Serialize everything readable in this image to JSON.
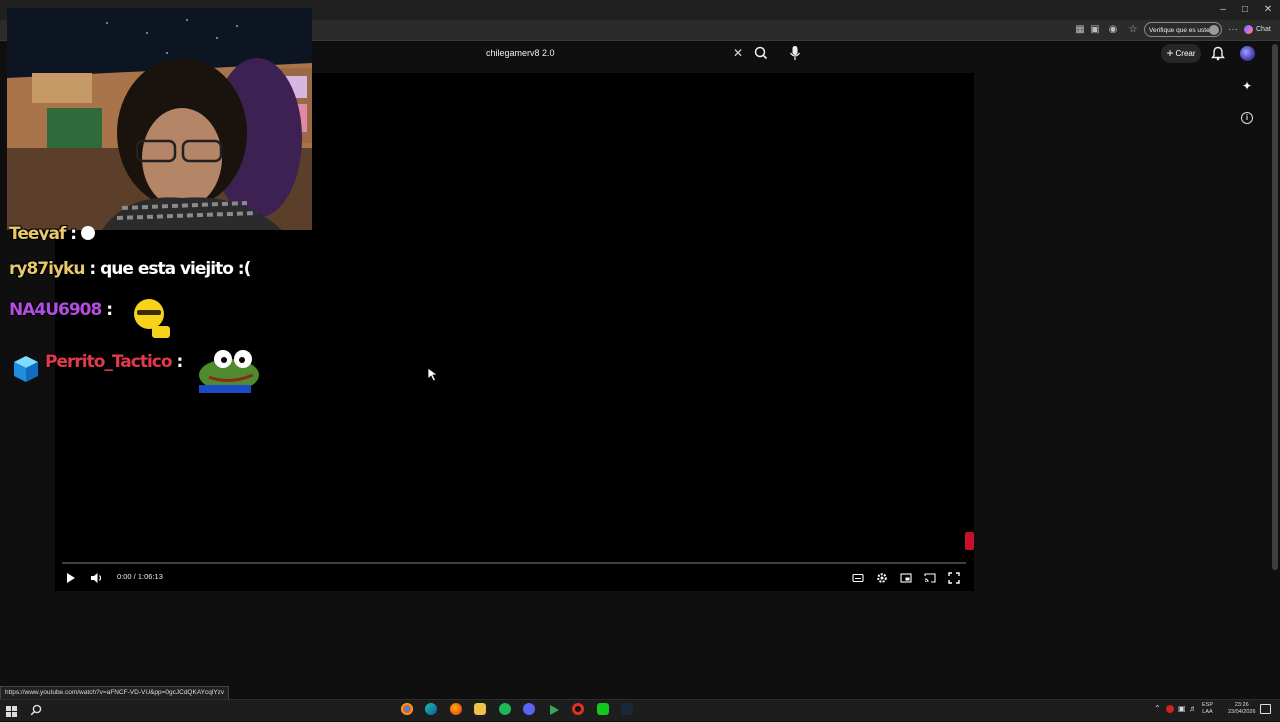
{
  "browser": {
    "verify_label": "Verifique que es usted",
    "chat_label": "Chat",
    "status_url": "https://www.youtube.com/watch?v=aFNCF-VD-VU&pp=0gcJCdQKAYcqlYzv"
  },
  "youtube": {
    "search_value": "chilegamerv8 2.0",
    "create_label": "Crear"
  },
  "player": {
    "time_display": "0:00 / 1:06:13",
    "progress_fraction": 0
  },
  "chat": [
    {
      "user": "Teeyaf",
      "message": ""
    },
    {
      "user": "ry87iyku",
      "message": "que esta viejito :("
    },
    {
      "user": "NA4U6908",
      "message": ""
    },
    {
      "user": "Perrito_Tactico",
      "message": ""
    }
  ],
  "taskbar": {
    "lang_line1": "ESP",
    "lang_line2": "LAA",
    "time": "23:26",
    "date": "23/04/2026"
  },
  "colors": {
    "name_user1": "#e9c76a",
    "name_user2": "#b34ee0",
    "name_user3": "#e23a4c",
    "accent_avatar": "#4b3fb5"
  }
}
